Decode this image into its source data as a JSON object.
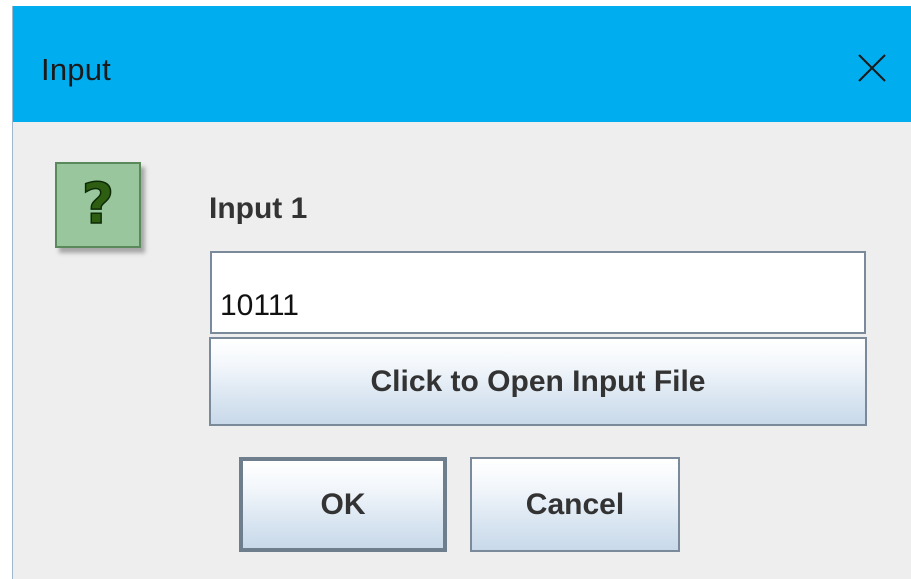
{
  "window": {
    "title": "Input",
    "titlebar_color": "#00adef"
  },
  "icons": {
    "close": "close-icon",
    "question": "question-icon"
  },
  "dialog": {
    "prompt_label": "Input 1",
    "input_value": "10111",
    "open_file_button": "Click to Open Input File",
    "ok_button": "OK",
    "cancel_button": "Cancel"
  }
}
